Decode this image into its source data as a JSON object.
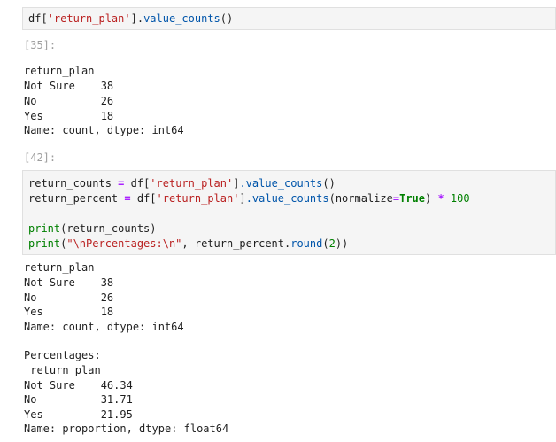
{
  "cell_1": {
    "code": {
      "var": "df",
      "open": "[",
      "key": "'return_plan'",
      "close": "]",
      "dot": ".",
      "method": "value_counts",
      "parens": "()"
    }
  },
  "cell_2": {
    "prompt": "[35]:",
    "output": [
      "return_plan",
      "Not Sure    38",
      "No          26",
      "Yes         18",
      "Name: count, dtype: int64"
    ]
  },
  "cell_3": {
    "prompt": "[42]:",
    "line1": {
      "lhs": "return_counts",
      "eq": " = ",
      "df": "df",
      "open": "[",
      "key": "'return_plan'",
      "close": "]",
      "method": ".value_counts",
      "parens": "()"
    },
    "line2": {
      "lhs": "return_percent",
      "eq": " = ",
      "df": "df",
      "open": "[",
      "key": "'return_plan'",
      "close": "]",
      "method": ".value_counts",
      "arg_open": "(normalize",
      "arg_eq": "=",
      "arg_val": "True",
      "arg_close": ")",
      "mul": " * ",
      "num": "100"
    },
    "line4": {
      "fn": "print",
      "arg": "(return_counts)"
    },
    "line5": {
      "fn": "print",
      "open": "(",
      "str": "\"\\nPercentages:\\n\"",
      "rest": ", return_percent.",
      "method": "round",
      "p_open": "(",
      "num": "2",
      "p_close": "))"
    },
    "output": [
      "return_plan",
      "Not Sure    38",
      "No          26",
      "Yes         18",
      "Name: count, dtype: int64",
      "",
      "Percentages:",
      " return_plan",
      "Not Sure    46.34",
      "No          31.71",
      "Yes         21.95",
      "Name: proportion, dtype: float64"
    ]
  }
}
